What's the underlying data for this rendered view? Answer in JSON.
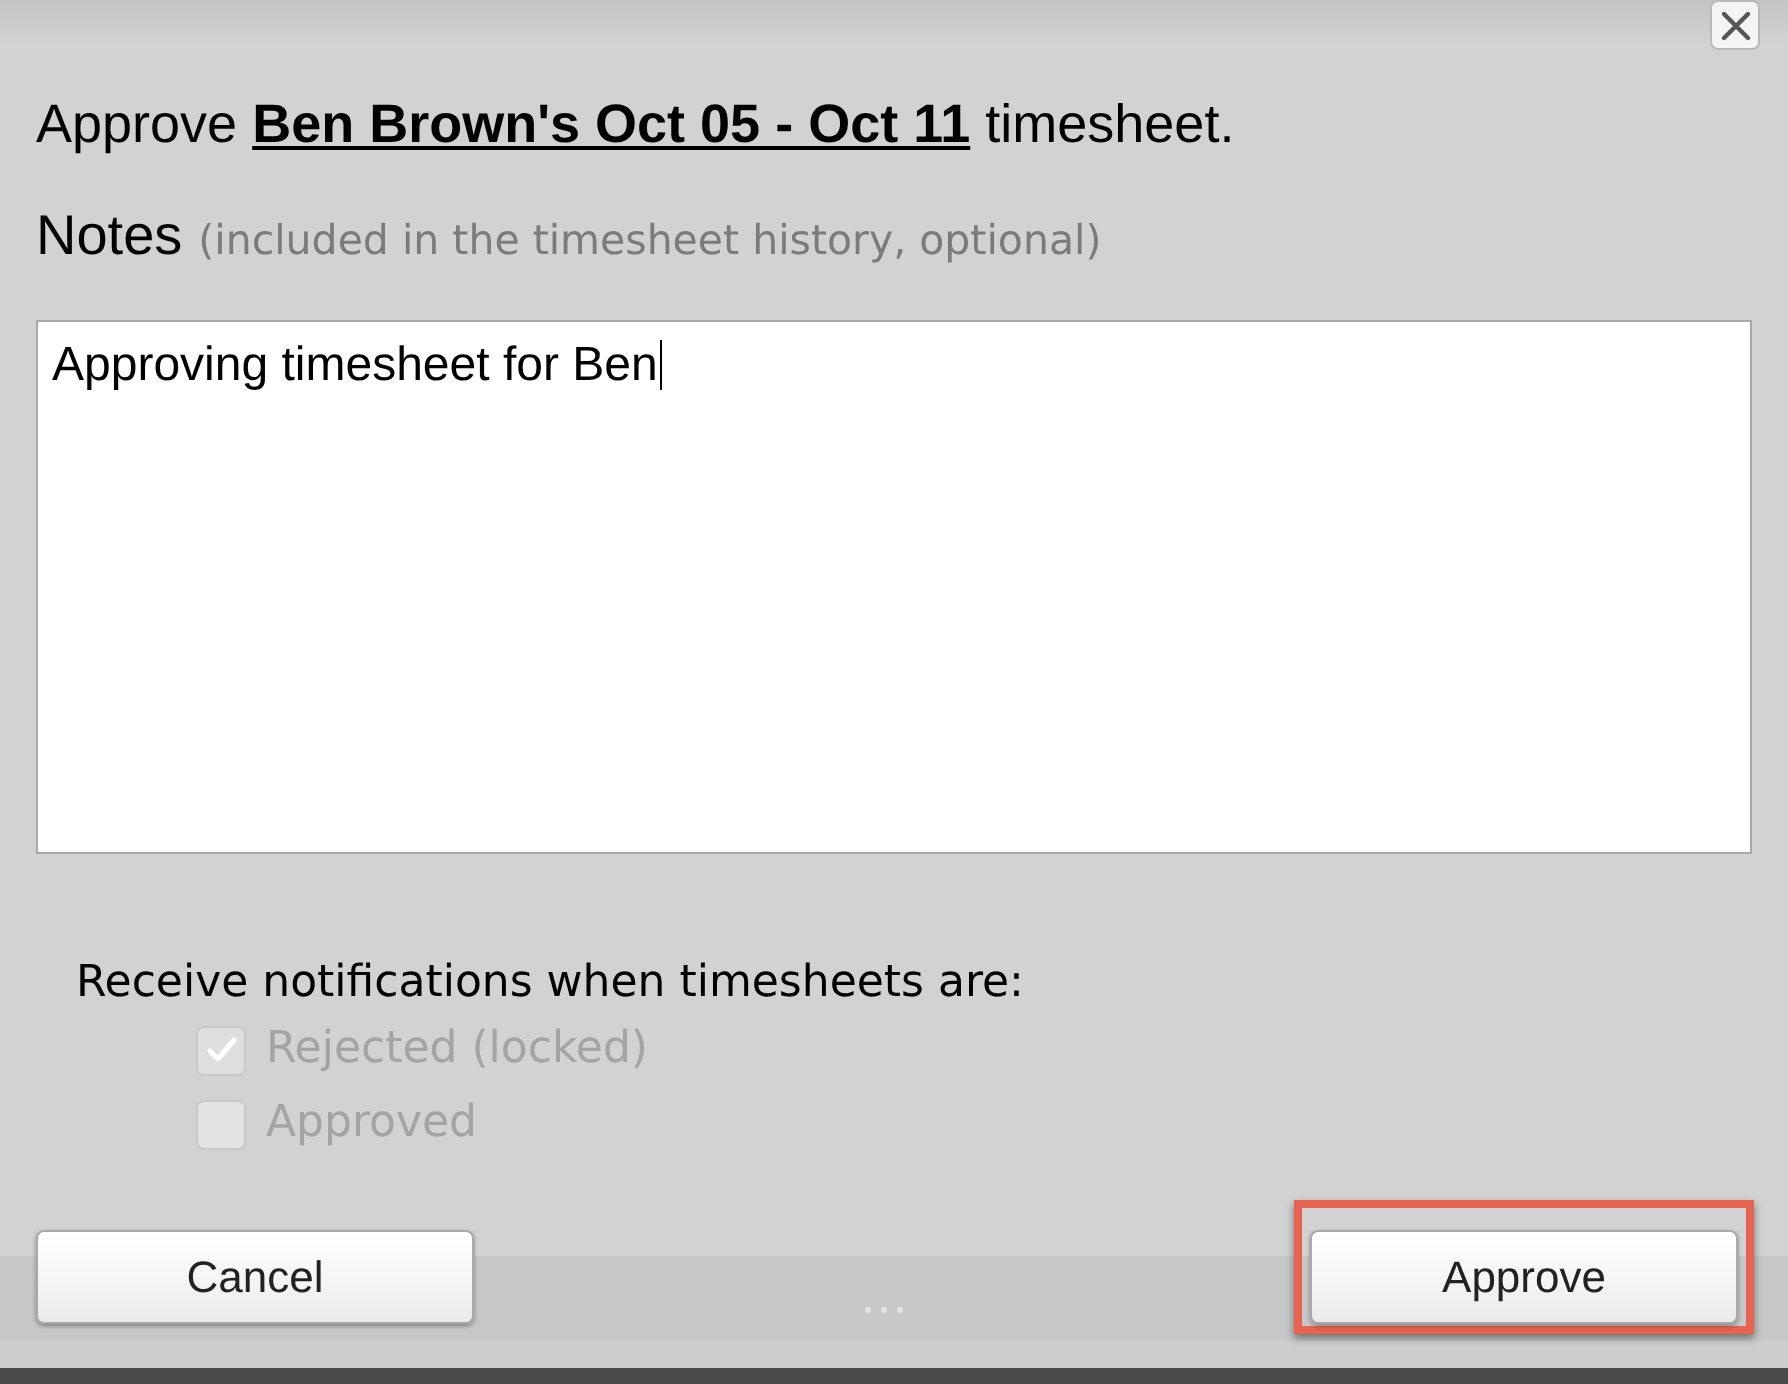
{
  "heading": {
    "prefix": "Approve",
    "link": "Ben Brown's Oct 05 - Oct 11",
    "suffix": "timesheet."
  },
  "notes": {
    "label": "Notes",
    "hint": "(included in the timesheet history, optional)",
    "value": "Approving timesheet for Ben"
  },
  "notifications": {
    "label": "Receive notifications when timesheets are:",
    "options": [
      {
        "label": "Rejected (locked)",
        "checked": true,
        "disabled": true
      },
      {
        "label": "Approved",
        "checked": false,
        "disabled": true
      }
    ]
  },
  "buttons": [
    {
      "label": "Cancel",
      "highlighted": false
    },
    {
      "label": "Approve",
      "highlighted": true
    }
  ]
}
